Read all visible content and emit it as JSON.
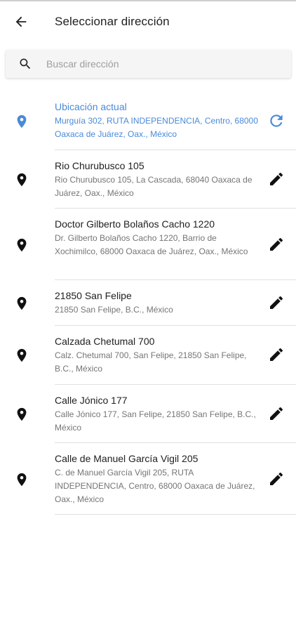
{
  "header": {
    "title": "Seleccionar dirección"
  },
  "search": {
    "placeholder": "Buscar dirección"
  },
  "current_location": {
    "label": "Ubicación actual",
    "address": "Murguía 302, RUTA INDEPENDENCIA, Centro, 68000 Oaxaca de Juárez, Oax., México"
  },
  "addresses": [
    {
      "name": "Rio Churubusco 105",
      "address": "Rio Churubusco 105, La Cascada, 68040 Oaxaca de Juárez, Oax., México"
    },
    {
      "name": "Doctor Gilberto Bolaños Cacho 1220",
      "address": "Dr. Gilberto Bolaños Cacho 1220, Barrio de Xochimilco, 68000 Oaxaca de Juárez, Oax., México"
    },
    {
      "name": "21850 San Felipe",
      "address": "21850 San Felipe, B.C., México"
    },
    {
      "name": "Calzada Chetumal 700",
      "address": "Calz. Chetumal 700, San Felipe, 21850 San Felipe, B.C., México"
    },
    {
      "name": "Calle Jónico 177",
      "address": "Calle Jónico 177, San Felipe, 21850 San Felipe, B.C., México"
    },
    {
      "name": "Calle de Manuel García Vigil 205",
      "address": "C. de Manuel García Vigil 205, RUTA INDEPENDENCIA, Centro, 68000 Oaxaca de Juárez, Oax., México"
    }
  ],
  "colors": {
    "accent": "#4a8ad8",
    "icon": "#111111",
    "divider": "#e0e0e0"
  },
  "icons": {
    "back": "arrow-left-icon",
    "search": "search-icon",
    "current": "location-pin-icon",
    "refresh": "refresh-icon",
    "address": "location-pin-icon",
    "edit": "pencil-icon"
  }
}
